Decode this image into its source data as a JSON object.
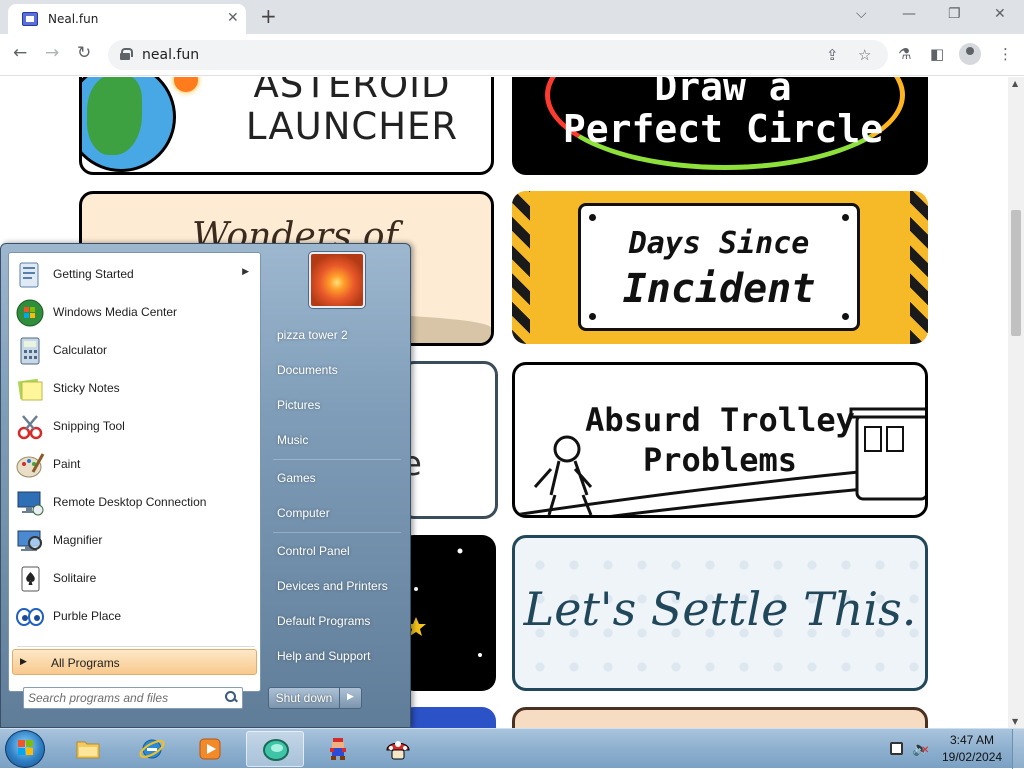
{
  "browser": {
    "tab": {
      "title": "Neal.fun",
      "close_glyph": "✕"
    },
    "new_tab_glyph": "+",
    "window_controls": {
      "tab_search": "⌵",
      "minimize": "—",
      "restore": "❐",
      "close": "✕"
    },
    "nav": {
      "back": "←",
      "forward": "→",
      "reload": "↻"
    },
    "address": {
      "url": "neal.fun"
    },
    "icons": {
      "share": "share-icon",
      "bookmark": "star-icon",
      "extensions": "puzzle-icon",
      "side_panel": "side-panel-icon",
      "profile": "profile-icon",
      "menu": "kebab-menu-icon"
    }
  },
  "page": {
    "cards": {
      "asteroid": {
        "line1": "ASTEROID",
        "line2": "LAUNCHER"
      },
      "circle": {
        "line1": "Draw a",
        "line2": "Perfect Circle"
      },
      "wonders": {
        "title": "Wonders of"
      },
      "days": {
        "line1": "Days Since",
        "line2": "Incident"
      },
      "partial_text": "e",
      "trolley": {
        "line1": "Absurd Trolley",
        "line2": "Problems"
      },
      "settle": {
        "title": "Let's Settle This."
      }
    }
  },
  "start_menu": {
    "programs": [
      {
        "label": "Getting Started",
        "icon": "getting-started-icon",
        "has_submenu": true
      },
      {
        "label": "Windows Media Center",
        "icon": "media-center-icon"
      },
      {
        "label": "Calculator",
        "icon": "calculator-icon"
      },
      {
        "label": "Sticky Notes",
        "icon": "sticky-notes-icon"
      },
      {
        "label": "Snipping Tool",
        "icon": "snipping-tool-icon"
      },
      {
        "label": "Paint",
        "icon": "paint-icon"
      },
      {
        "label": "Remote Desktop Connection",
        "icon": "remote-desktop-icon"
      },
      {
        "label": "Magnifier",
        "icon": "magnifier-icon"
      },
      {
        "label": "Solitaire",
        "icon": "solitaire-icon"
      },
      {
        "label": "Purble Place",
        "icon": "purble-place-icon"
      }
    ],
    "all_programs": "All Programs",
    "search_placeholder": "Search programs and files",
    "places": [
      {
        "label": "pizza tower 2"
      },
      {
        "label": "Documents"
      },
      {
        "label": "Pictures"
      },
      {
        "label": "Music"
      },
      {
        "label": "Games"
      },
      {
        "label": "Computer"
      },
      {
        "label": "Control Panel"
      },
      {
        "label": "Devices and Printers"
      },
      {
        "label": "Default Programs"
      },
      {
        "label": "Help and Support"
      }
    ],
    "shutdown": "Shut down",
    "shutdown_arrow": "▶"
  },
  "taskbar": {
    "apps": [
      {
        "name": "explorer",
        "icon": "folder-icon"
      },
      {
        "name": "internet-explorer",
        "icon": "ie-icon"
      },
      {
        "name": "media-player",
        "icon": "media-player-icon"
      },
      {
        "name": "chrome-like-app",
        "icon": "browser-icon",
        "active": true
      },
      {
        "name": "mario",
        "icon": "mario-icon"
      },
      {
        "name": "mushroom",
        "icon": "mushroom-icon"
      }
    ],
    "clock": {
      "time": "3:47 AM",
      "date": "19/02/2024"
    }
  },
  "colors": {
    "accent": "#f8c98d",
    "taskbar": "#8eb0cf",
    "card_yellow": "#f6b928",
    "settle": "#20475a"
  }
}
